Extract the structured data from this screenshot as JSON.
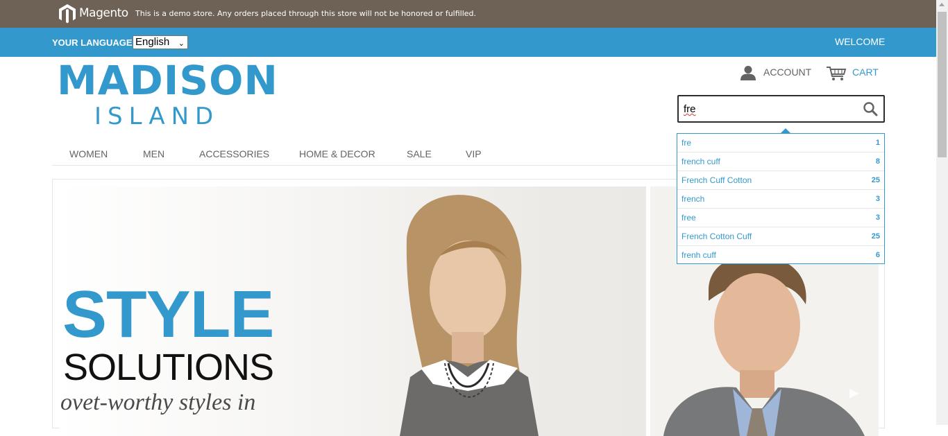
{
  "demo_notice": {
    "brand": "Magento",
    "text": "This is a demo store. Any orders placed through this store will not be honored or fulfilled."
  },
  "header_bar": {
    "language_label": "YOUR LANGUAGE:",
    "language_selected": "English",
    "welcome": "WELCOME"
  },
  "logo": {
    "main": "MADISON",
    "sub": "ISLAND"
  },
  "account": {
    "label": "ACCOUNT",
    "icon": "user-icon"
  },
  "cart": {
    "label": "CART",
    "icon": "cart-icon"
  },
  "search": {
    "value": "fre",
    "icon": "search-icon"
  },
  "nav": {
    "items": [
      "WOMEN",
      "MEN",
      "ACCESSORIES",
      "HOME & DECOR",
      "SALE",
      "VIP"
    ]
  },
  "autocomplete": {
    "suggestions": [
      {
        "label": "fre",
        "count": "1"
      },
      {
        "label": "french cuff",
        "count": "8"
      },
      {
        "label": "French Cuff Cotton",
        "count": "25"
      },
      {
        "label": "french",
        "count": "3"
      },
      {
        "label": "free",
        "count": "3"
      },
      {
        "label": "French Cotton Cuff",
        "count": "25"
      },
      {
        "label": "frenh cuff",
        "count": "6"
      }
    ]
  },
  "hero": {
    "headline": "STYLE",
    "subheadline": "SOLUTIONS",
    "tagline": "ovet-worthy styles in"
  },
  "colors": {
    "accent": "#3399cc",
    "demo_bar": "#6e6257",
    "text": "#636363"
  }
}
